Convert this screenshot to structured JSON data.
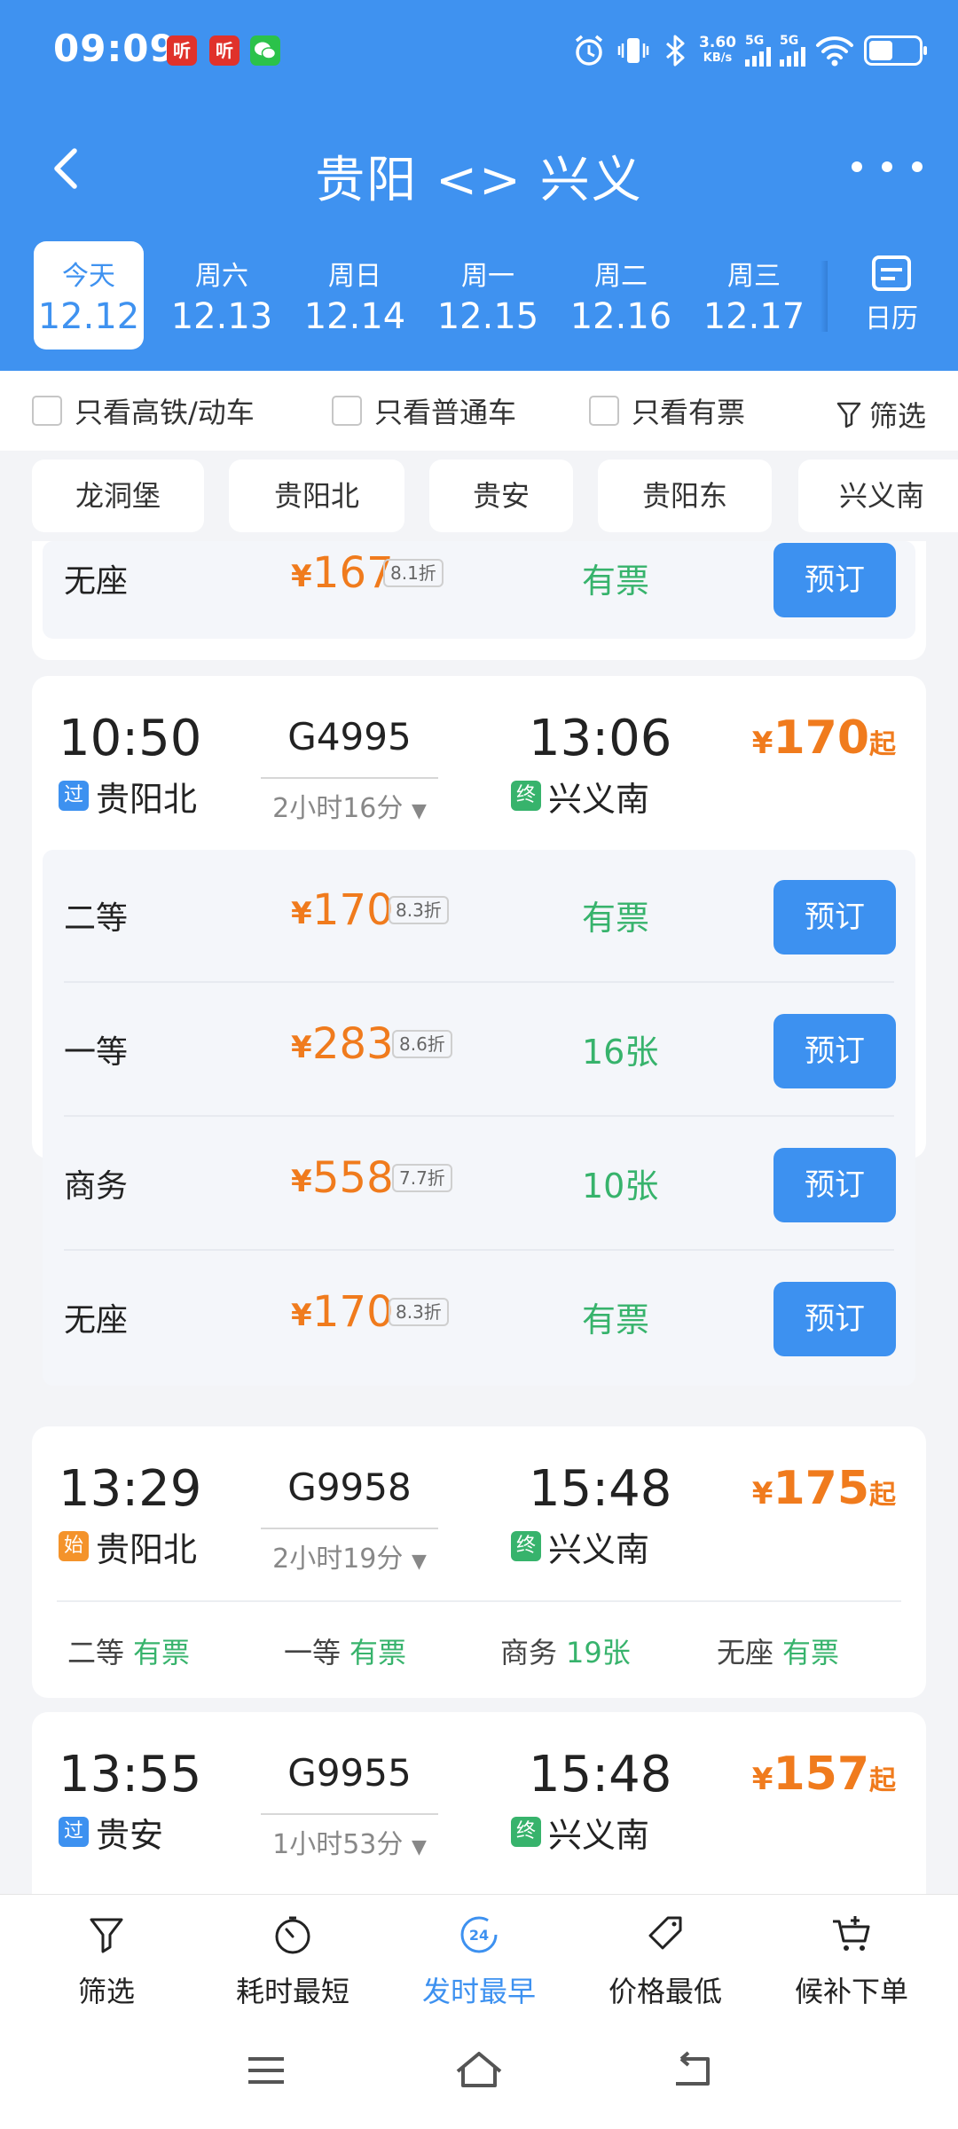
{
  "status": {
    "time": "09:09",
    "app_icons": [
      "听",
      "听"
    ],
    "net_speed_value": "3.60",
    "net_speed_unit": "KB/s",
    "sim1": "5G",
    "sim2": "5G"
  },
  "nav": {
    "title": "贵阳 <> 兴义"
  },
  "dates": [
    {
      "weekday": "今天",
      "date": "12.12"
    },
    {
      "weekday": "周六",
      "date": "12.13"
    },
    {
      "weekday": "周日",
      "date": "12.14"
    },
    {
      "weekday": "周一",
      "date": "12.15"
    },
    {
      "weekday": "周二",
      "date": "12.16"
    },
    {
      "weekday": "周三",
      "date": "12.17"
    }
  ],
  "calendar_label": "日历",
  "filters": {
    "high_speed_only": "只看高铁/动车",
    "normal_only": "只看普通车",
    "available_only": "只看有票",
    "filter": "筛选"
  },
  "stations": [
    "龙洞堡",
    "贵阳北",
    "贵安",
    "贵阳东",
    "兴义南"
  ],
  "partial_card": {
    "seat": {
      "class": "无座",
      "yen": "¥",
      "price": "167",
      "discount": "8.1折",
      "availability": "有票",
      "book": "预订"
    }
  },
  "trains": [
    {
      "dep_time": "10:50",
      "train_no": "G4995",
      "duration": "2小时16分",
      "arr_time": "13:06",
      "dep_tag": "过",
      "dep_station": "贵阳北",
      "arr_tag": "终",
      "arr_station": "兴义南",
      "yen": "¥",
      "price": "170",
      "qi": "起",
      "seats": [
        {
          "class": "二等",
          "yen": "¥",
          "price": "170",
          "discount": "8.3折",
          "availability": "有票",
          "book": "预订"
        },
        {
          "class": "一等",
          "yen": "¥",
          "price": "283",
          "discount": "8.6折",
          "availability": "16张",
          "book": "预订"
        },
        {
          "class": "商务",
          "yen": "¥",
          "price": "558",
          "discount": "7.7折",
          "availability": "10张",
          "book": "预订"
        },
        {
          "class": "无座",
          "yen": "¥",
          "price": "170",
          "discount": "8.3折",
          "availability": "有票",
          "book": "预订"
        }
      ]
    },
    {
      "dep_time": "13:29",
      "train_no": "G9958",
      "duration": "2小时19分",
      "arr_time": "15:48",
      "dep_tag": "始",
      "dep_station": "贵阳北",
      "arr_tag": "终",
      "arr_station": "兴义南",
      "yen": "¥",
      "price": "175",
      "qi": "起",
      "summary": [
        {
          "class": "二等",
          "availability": "有票"
        },
        {
          "class": "一等",
          "availability": "有票"
        },
        {
          "class": "商务",
          "availability": "19张"
        },
        {
          "class": "无座",
          "availability": "有票"
        }
      ]
    },
    {
      "dep_time": "13:55",
      "train_no": "G9955",
      "duration": "1小时53分",
      "arr_time": "15:48",
      "dep_tag": "过",
      "dep_station": "贵安",
      "arr_tag": "终",
      "arr_station": "兴义南",
      "yen": "¥",
      "price": "157",
      "qi": "起"
    }
  ],
  "tabs": [
    {
      "label": "筛选",
      "icon": "funnel-icon"
    },
    {
      "label": "耗时最短",
      "icon": "stopwatch-icon"
    },
    {
      "label": "发时最早",
      "icon": "clock-24-icon",
      "badge": "24"
    },
    {
      "label": "价格最低",
      "icon": "price-tag-icon"
    },
    {
      "label": "候补下单",
      "icon": "cart-plus-icon"
    }
  ],
  "colors": {
    "primary": "#3f92f0",
    "price": "#f07b1d",
    "available": "#37b36c",
    "pass_tag": "#3d91f0",
    "start_tag": "#f4932b",
    "end_tag": "#37b36c"
  }
}
